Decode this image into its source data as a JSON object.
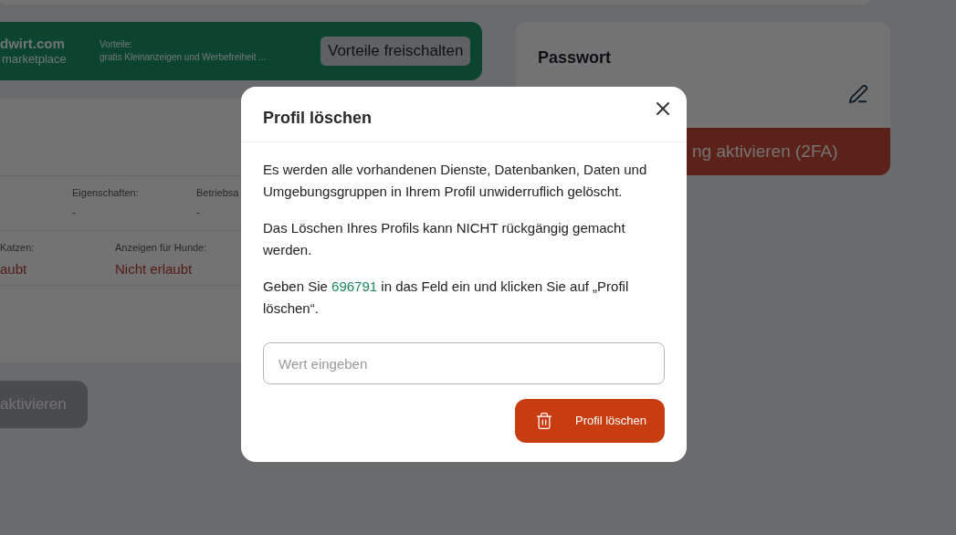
{
  "banner": {
    "brand": "dwirt.com",
    "tagline": "marketplace",
    "benefits_label": "Vorteile:",
    "benefits_text": "gratis Kleinanzeigen und Werbefreiheit ...",
    "button": "Vorteile freischalten"
  },
  "details": {
    "rows": [
      {
        "cells": [
          {
            "kind": "text",
            "label": "Eigenschaften:",
            "value": "-"
          },
          {
            "kind": "text",
            "label": "Betriebsa",
            "value": "-"
          }
        ]
      },
      {
        "cells": [
          {
            "kind": "status",
            "label": "Katzen:",
            "value": "aubt",
            "allowed": false
          },
          {
            "kind": "status",
            "label": "Anzeigen für Hunde:",
            "value": "Nicht erlaubt",
            "allowed": false
          }
        ]
      }
    ]
  },
  "bottom_button": {
    "label": "aktivieren",
    "disabled": true
  },
  "password": {
    "title": "Passwort",
    "twofa_button": "ng aktivieren (2FA)"
  },
  "dialog": {
    "title": "Profil löschen",
    "paragraphs": [
      "Es werden alle vorhandenen Dienste, Datenbanken, Daten und Umgebungsgruppen in Ihrem Profil unwiderruflich gelöscht.",
      "Das Löschen Ihres Profils kann NICHT rückgängig gemacht werden."
    ],
    "prompt_before": "Geben Sie ",
    "code": "696791",
    "prompt_after": " in das Feld ein und klicken Sie auf „Profil löschen“.",
    "placeholder": "Wert eingeben",
    "delete_button": "Profil löschen"
  }
}
